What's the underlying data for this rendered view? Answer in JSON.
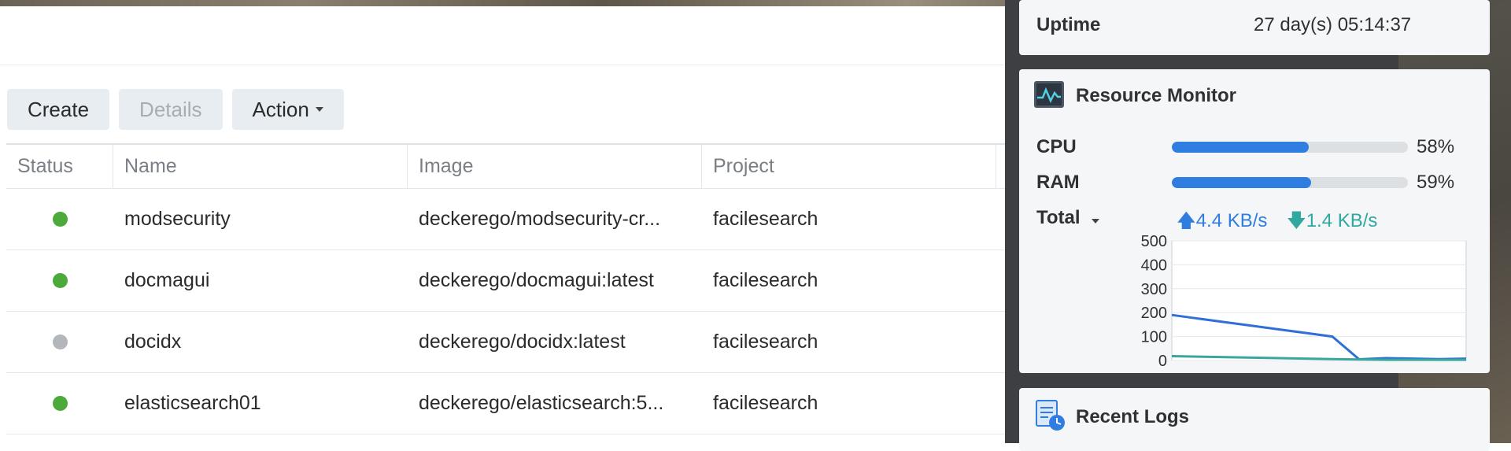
{
  "toolbar": {
    "create": "Create",
    "details": "Details",
    "action": "Action"
  },
  "table": {
    "headers": [
      "Status",
      "Name",
      "Image",
      "Project"
    ],
    "rows": [
      {
        "status": "running",
        "name": "modsecurity",
        "image": "deckerego/modsecurity-cr...",
        "project": "facilesearch"
      },
      {
        "status": "running",
        "name": "docmagui",
        "image": "deckerego/docmagui:latest",
        "project": "facilesearch"
      },
      {
        "status": "stopped",
        "name": "docidx",
        "image": "deckerego/docidx:latest",
        "project": "facilesearch"
      },
      {
        "status": "running",
        "name": "elasticsearch01",
        "image": "deckerego/elasticsearch:5...",
        "project": "facilesearch"
      }
    ]
  },
  "uptime": {
    "label": "Uptime",
    "value": "27 day(s) 05:14:37"
  },
  "resource_monitor": {
    "title": "Resource Monitor",
    "icon": "resource-monitor-icon",
    "cpu": {
      "label": "CPU",
      "percent": 58,
      "text": "58%"
    },
    "ram": {
      "label": "RAM",
      "percent": 59,
      "text": "59%"
    },
    "total": {
      "label": "Total",
      "up": "4.4 KB/s",
      "down": "1.4 KB/s"
    },
    "chart_data": {
      "type": "line",
      "ylim": [
        0,
        500
      ],
      "yticks": [
        "500",
        "400",
        "300",
        "200",
        "100",
        "0"
      ],
      "series": [
        {
          "color": "#2f6fd6",
          "values": [
            190,
            175,
            160,
            145,
            130,
            115,
            100,
            5,
            10,
            8,
            6,
            8
          ]
        },
        {
          "color": "#3aa79c",
          "values": [
            18,
            16,
            14,
            12,
            10,
            8,
            6,
            4,
            3,
            3,
            3,
            3
          ]
        }
      ]
    }
  },
  "recent_logs": {
    "title": "Recent Logs",
    "icon": "recent-logs-icon"
  },
  "colors": {
    "accent_blue": "#2f7de0",
    "teal": "#2fa8a0",
    "green": "#4caa3a",
    "gray": "#b3b7bc"
  }
}
